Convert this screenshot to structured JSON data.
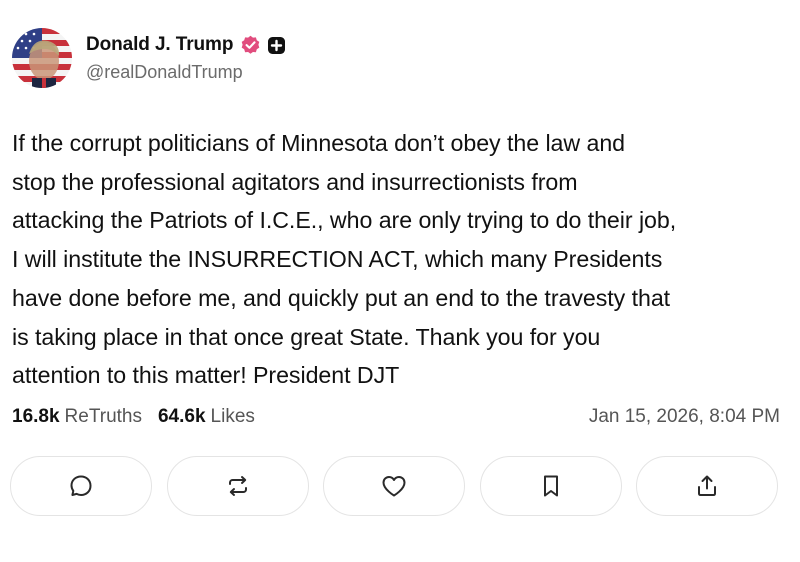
{
  "author": {
    "display_name": "Donald J. Trump",
    "handle": "@realDonaldTrump",
    "avatar_icon": "avatar-flag-portrait",
    "verified_icon": "verified-badge-icon",
    "plus_icon": "plus-badge-icon"
  },
  "post": {
    "text": "If the corrupt politicians of Minnesota don’t obey the law and\nstop the professional agitators and insurrectionists from\nattacking the Patriots of I.C.E., who are only trying to do their job,\nI will institute the INSURRECTION ACT, which many Presidents\nhave done before me, and quickly put an end to the travesty that\nis taking place in that once great State. Thank you for you\nattention to this matter! President DJT"
  },
  "stats": {
    "retruths_count": "16.8k",
    "retruths_label": "ReTruths",
    "likes_count": "64.6k",
    "likes_label": "Likes",
    "timestamp": "Jan 15, 2026, 8:04 PM"
  },
  "actions": {
    "reply_icon": "reply-icon",
    "retruth_icon": "retruth-icon",
    "like_icon": "heart-icon",
    "bookmark_icon": "bookmark-icon",
    "share_icon": "share-icon"
  },
  "colors": {
    "verified": "#e14d7e",
    "text": "#111111",
    "muted": "#6b6b6b",
    "border": "#e4e4e4"
  }
}
